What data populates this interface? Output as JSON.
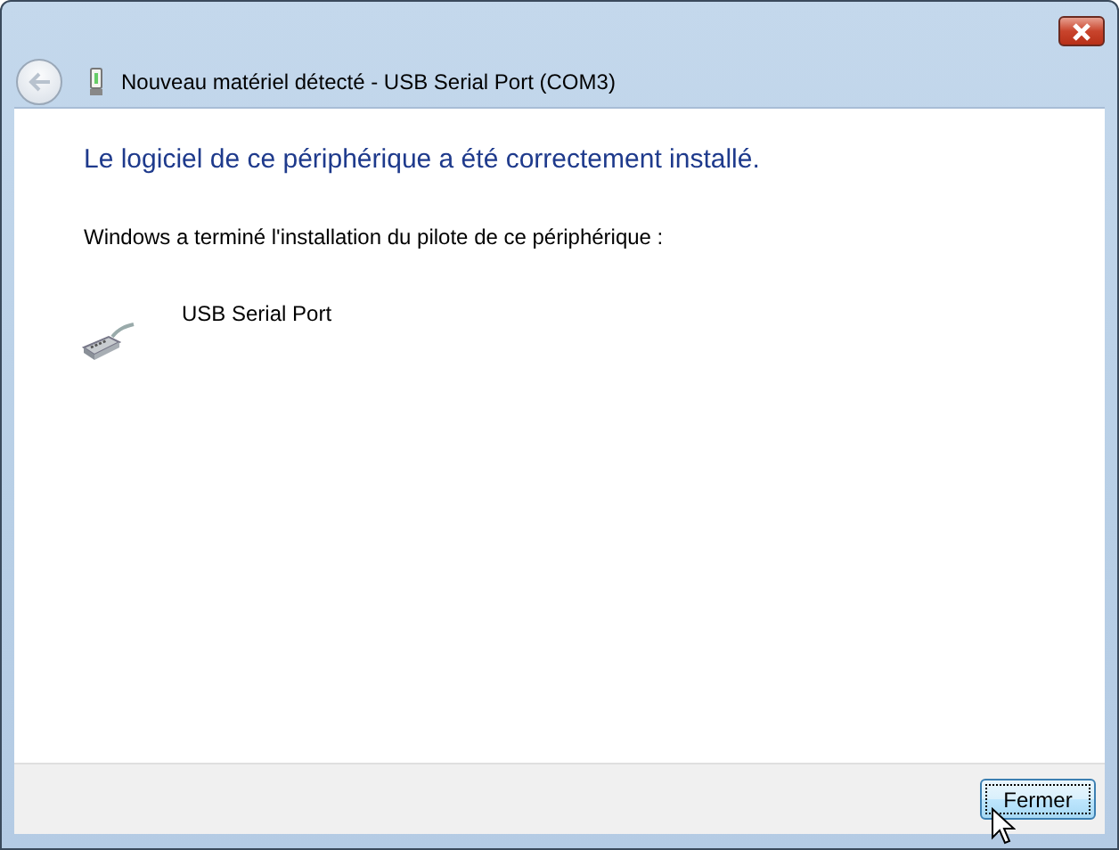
{
  "window": {
    "title": "Nouveau matériel détecté - USB Serial Port (COM3)"
  },
  "back_button": {
    "disabled": true
  },
  "heading": "Le logiciel de ce périphérique a été correctement installé.",
  "message": "Windows a terminé l'installation du pilote de ce périphérique :",
  "devices": [
    {
      "name": "USB Serial Port"
    }
  ],
  "buttons": [
    {
      "label": "Fermer",
      "focused": true
    }
  ]
}
